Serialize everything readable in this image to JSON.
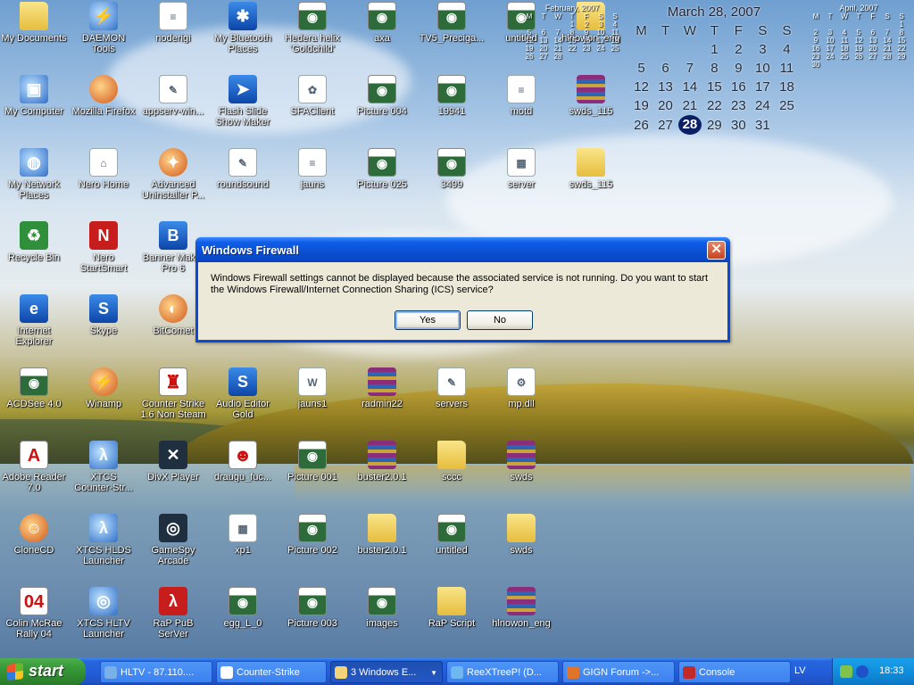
{
  "desktop": {
    "icons": [
      {
        "id": "my-documents",
        "label": "My Documents",
        "kind": "folder",
        "glyph": "",
        "shortcut": false
      },
      {
        "id": "daemon-tools",
        "label": "DAEMON Tools",
        "kind": "sys",
        "glyph": "⚡",
        "shortcut": true
      },
      {
        "id": "noderigi",
        "label": "noderigi",
        "kind": "doc",
        "glyph": "≡",
        "shortcut": false
      },
      {
        "id": "my-bluetooth-places",
        "label": "My Bluetooth\nPlaces",
        "kind": "blue",
        "glyph": "✱",
        "shortcut": false
      },
      {
        "id": "hedera-helix",
        "label": "Hedera helix\n'Goldchild'",
        "kind": "jpg",
        "glyph": "◉",
        "shortcut": false
      },
      {
        "id": "axa",
        "label": "axa",
        "kind": "jpg",
        "glyph": "◉",
        "shortcut": false
      },
      {
        "id": "tv5-precigaro",
        "label": "TV5_Preciga...",
        "kind": "jpg",
        "glyph": "◉",
        "shortcut": false
      },
      {
        "id": "untitled-psd",
        "label": "untitled",
        "kind": "jpg",
        "glyph": "◉",
        "shortcut": false
      },
      {
        "id": "hlnowon-eng-top",
        "label": "hlnowon_eng",
        "kind": "folder",
        "glyph": "",
        "shortcut": false
      },
      {
        "id": "my-computer",
        "label": "My Computer",
        "kind": "sys",
        "glyph": "▣",
        "shortcut": false
      },
      {
        "id": "mozilla-firefox",
        "label": "Mozilla Firefox",
        "kind": "app",
        "glyph": "",
        "shortcut": true
      },
      {
        "id": "appserv-win",
        "label": "appserv-win...",
        "kind": "doc",
        "glyph": "✎",
        "shortcut": false
      },
      {
        "id": "flash-slide-show-maker",
        "label": "Flash Slide\nShow Maker",
        "kind": "blue",
        "glyph": "➤",
        "shortcut": true
      },
      {
        "id": "sfaclient",
        "label": "SFAClient",
        "kind": "doc",
        "glyph": "✿",
        "shortcut": false
      },
      {
        "id": "picture-004",
        "label": "Picture 004",
        "kind": "jpg",
        "glyph": "◉",
        "shortcut": false
      },
      {
        "id": "19941",
        "label": "19941",
        "kind": "jpg",
        "glyph": "◉",
        "shortcut": false
      },
      {
        "id": "motd",
        "label": "motd",
        "kind": "doc",
        "glyph": "≡",
        "shortcut": false
      },
      {
        "id": "swds-115-a",
        "label": "swds_115",
        "kind": "rar",
        "glyph": "",
        "shortcut": false
      },
      {
        "id": "my-network-places",
        "label": "My Network\nPlaces",
        "kind": "sys",
        "glyph": "◍",
        "shortcut": false
      },
      {
        "id": "nero-home",
        "label": "Nero Home",
        "kind": "doc",
        "glyph": "⌂",
        "shortcut": true
      },
      {
        "id": "advanced-uninstaller",
        "label": "Advanced\nUninstaller P...",
        "kind": "app",
        "glyph": "✦",
        "shortcut": true
      },
      {
        "id": "roundsound",
        "label": "roundsound",
        "kind": "doc",
        "glyph": "✎",
        "shortcut": false
      },
      {
        "id": "jauns",
        "label": "jauns",
        "kind": "doc",
        "glyph": "≡",
        "shortcut": false
      },
      {
        "id": "picture-025",
        "label": "Picture 025",
        "kind": "jpg",
        "glyph": "◉",
        "shortcut": false
      },
      {
        "id": "3499",
        "label": "3499",
        "kind": "jpg",
        "glyph": "◉",
        "shortcut": false
      },
      {
        "id": "server",
        "label": "server",
        "kind": "doc",
        "glyph": "▦",
        "shortcut": false
      },
      {
        "id": "swds-115-b",
        "label": "swds_115",
        "kind": "folder",
        "glyph": "",
        "shortcut": false
      },
      {
        "id": "recycle-bin",
        "label": "Recycle Bin",
        "kind": "green",
        "glyph": "♻",
        "shortcut": false
      },
      {
        "id": "nero-startsmart",
        "label": "Nero\nStartSmart",
        "kind": "red",
        "glyph": "N",
        "shortcut": true
      },
      {
        "id": "banner-maker",
        "label": "Banner Mak...\nPro 6",
        "kind": "blue",
        "glyph": "B",
        "shortcut": true
      },
      {
        "id": "internet-explorer",
        "label": "Internet\nExplorer",
        "kind": "blue",
        "glyph": "e",
        "shortcut": false
      },
      {
        "id": "skype",
        "label": "Skype",
        "kind": "blue",
        "glyph": "S",
        "shortcut": true
      },
      {
        "id": "bitcomet",
        "label": "BitComet",
        "kind": "app",
        "glyph": "◐",
        "shortcut": true
      },
      {
        "id": "acdsee",
        "label": "ACDSee 4.0",
        "kind": "jpg",
        "glyph": "◉",
        "shortcut": true
      },
      {
        "id": "winamp",
        "label": "Winamp",
        "kind": "app",
        "glyph": "⚡",
        "shortcut": true
      },
      {
        "id": "counter-strike-16",
        "label": "Counter Strike\n1.6 Non Steam",
        "kind": "white",
        "glyph": "♜",
        "shortcut": true
      },
      {
        "id": "audio-editor-gold",
        "label": "Audio Editor\nGold",
        "kind": "blue",
        "glyph": "S",
        "shortcut": true
      },
      {
        "id": "jauns1",
        "label": "jauns1",
        "kind": "doc",
        "glyph": "W",
        "shortcut": false
      },
      {
        "id": "radmin22",
        "label": "radmin22",
        "kind": "rar",
        "glyph": "",
        "shortcut": false
      },
      {
        "id": "servers",
        "label": "servers",
        "kind": "doc",
        "glyph": "✎",
        "shortcut": false
      },
      {
        "id": "mp-dll",
        "label": "mp.dll",
        "kind": "doc",
        "glyph": "⚙",
        "shortcut": false
      },
      {
        "id": "adobe-reader",
        "label": "Adobe Reader\n7.0",
        "kind": "white",
        "glyph": "A",
        "shortcut": true
      },
      {
        "id": "xtcs-counter-strike",
        "label": "XTCS\nCounter-Str...",
        "kind": "sys",
        "glyph": "λ",
        "shortcut": true
      },
      {
        "id": "divx-player",
        "label": "DivX Player",
        "kind": "dark",
        "glyph": "✕",
        "shortcut": true
      },
      {
        "id": "draugu-fuc",
        "label": "draugu_fuc...",
        "kind": "white",
        "glyph": "☻",
        "shortcut": false
      },
      {
        "id": "picture-001",
        "label": "Picture 001",
        "kind": "jpg",
        "glyph": "◉",
        "shortcut": false
      },
      {
        "id": "buster-201-a",
        "label": "buster2.0.1",
        "kind": "rar",
        "glyph": "",
        "shortcut": false
      },
      {
        "id": "sccc",
        "label": "sccc",
        "kind": "folder",
        "glyph": "",
        "shortcut": false
      },
      {
        "id": "swds-a",
        "label": "swds",
        "kind": "rar",
        "glyph": "",
        "shortcut": false
      },
      {
        "id": "clonecd",
        "label": "CloneCD",
        "kind": "app",
        "glyph": "☺",
        "shortcut": true
      },
      {
        "id": "xtcs-hlds-launcher",
        "label": "XTCS HLDS\nLauncher",
        "kind": "sys",
        "glyph": "λ",
        "shortcut": true
      },
      {
        "id": "gamespy-arcade",
        "label": "GameSpy\nArcade",
        "kind": "dark",
        "glyph": "◎",
        "shortcut": true
      },
      {
        "id": "xp1",
        "label": "xp1",
        "kind": "doc",
        "glyph": "▦",
        "shortcut": false
      },
      {
        "id": "picture-002",
        "label": "Picture 002",
        "kind": "jpg",
        "glyph": "◉",
        "shortcut": false
      },
      {
        "id": "buster-201-b",
        "label": "buster2.0.1",
        "kind": "folder",
        "glyph": "",
        "shortcut": false
      },
      {
        "id": "untitled-bmp",
        "label": "untitled",
        "kind": "jpg",
        "glyph": "◉",
        "shortcut": false
      },
      {
        "id": "swds-b",
        "label": "swds",
        "kind": "folder",
        "glyph": "",
        "shortcut": false
      },
      {
        "id": "colin-mcrae",
        "label": "Colin McRae\nRally 04",
        "kind": "white",
        "glyph": "04",
        "shortcut": true
      },
      {
        "id": "xtcs-hltv-launcher",
        "label": "XTCS HLTV\nLauncher",
        "kind": "sys",
        "glyph": "◎",
        "shortcut": true
      },
      {
        "id": "rap-pub-server",
        "label": "RaP PuB\nSerVer",
        "kind": "red",
        "glyph": "λ",
        "shortcut": true
      },
      {
        "id": "egg-l-0",
        "label": "egg_L_0",
        "kind": "jpg",
        "glyph": "◉",
        "shortcut": false
      },
      {
        "id": "picture-003",
        "label": "Picture 003",
        "kind": "jpg",
        "glyph": "◉",
        "shortcut": false
      },
      {
        "id": "images",
        "label": "images",
        "kind": "jpg",
        "glyph": "◉",
        "shortcut": false
      },
      {
        "id": "rap-script",
        "label": "RaP Script",
        "kind": "folder",
        "glyph": "",
        "shortcut": false
      },
      {
        "id": "hlnowon-eng",
        "label": "hlnowon_eng",
        "kind": "rar",
        "glyph": "",
        "shortcut": false
      }
    ]
  },
  "calendar": {
    "prev": {
      "caption": "February, 2007",
      "weekdays": [
        "M",
        "T",
        "W",
        "T",
        "F",
        "S",
        "S"
      ],
      "rows": [
        [
          "",
          "",
          "",
          "1",
          "2",
          "3",
          "4"
        ],
        [
          "5",
          "6",
          "7",
          "8",
          "9",
          "10",
          "11"
        ],
        [
          "12",
          "13",
          "14",
          "15",
          "16",
          "17",
          "18"
        ],
        [
          "19",
          "20",
          "21",
          "22",
          "23",
          "24",
          "25"
        ],
        [
          "26",
          "27",
          "28",
          "",
          "",
          "",
          ""
        ]
      ]
    },
    "current": {
      "caption": "March 28, 2007",
      "weekdays": [
        "M",
        "T",
        "W",
        "T",
        "F",
        "S",
        "S"
      ],
      "rows": [
        [
          "",
          "",
          "",
          "1",
          "2",
          "3",
          "4"
        ],
        [
          "5",
          "6",
          "7",
          "8",
          "9",
          "10",
          "11"
        ],
        [
          "12",
          "13",
          "14",
          "15",
          "16",
          "17",
          "18"
        ],
        [
          "19",
          "20",
          "21",
          "22",
          "23",
          "24",
          "25"
        ],
        [
          "26",
          "27",
          "28",
          "29",
          "30",
          "31",
          ""
        ]
      ],
      "today": "28"
    },
    "next": {
      "caption": "April, 2007",
      "weekdays": [
        "M",
        "T",
        "W",
        "T",
        "F",
        "S",
        "S"
      ],
      "rows": [
        [
          "",
          "",
          "",
          "",
          "",
          "",
          "1"
        ],
        [
          "2",
          "3",
          "4",
          "5",
          "6",
          "7",
          "8"
        ],
        [
          "9",
          "10",
          "11",
          "12",
          "13",
          "14",
          "15"
        ],
        [
          "16",
          "17",
          "18",
          "19",
          "20",
          "21",
          "22"
        ],
        [
          "23",
          "24",
          "25",
          "26",
          "27",
          "28",
          "29"
        ],
        [
          "30",
          "",
          "",
          "",
          "",
          "",
          ""
        ]
      ]
    }
  },
  "dialog": {
    "title": "Windows Firewall",
    "close_label": "✕",
    "message": "Windows Firewall settings cannot be displayed because the associated service is not running. Do you want to start the Windows Firewall/Internet Connection Sharing (ICS) service?",
    "yes_label": "Yes",
    "no_label": "No"
  },
  "taskbar": {
    "start_label": "start",
    "buttons": [
      {
        "label": "HLTV - 87.110....",
        "icon_color": "#7ab0e8",
        "active": false
      },
      {
        "label": "Counter-Strike",
        "icon_color": "#ffffff",
        "active": false
      },
      {
        "label": "3 Windows E...",
        "icon_color": "#f2d37a",
        "active": true,
        "grouped": true
      },
      {
        "label": "ReeXTreeP! (D...",
        "icon_color": "#6fb7f0",
        "active": false
      },
      {
        "label": "GIGN Forum ->...",
        "icon_color": "#e0742a",
        "active": false
      },
      {
        "label": "Console",
        "icon_color": "#c22a2a",
        "active": false
      }
    ],
    "language": "LV",
    "clock": "18:33"
  }
}
